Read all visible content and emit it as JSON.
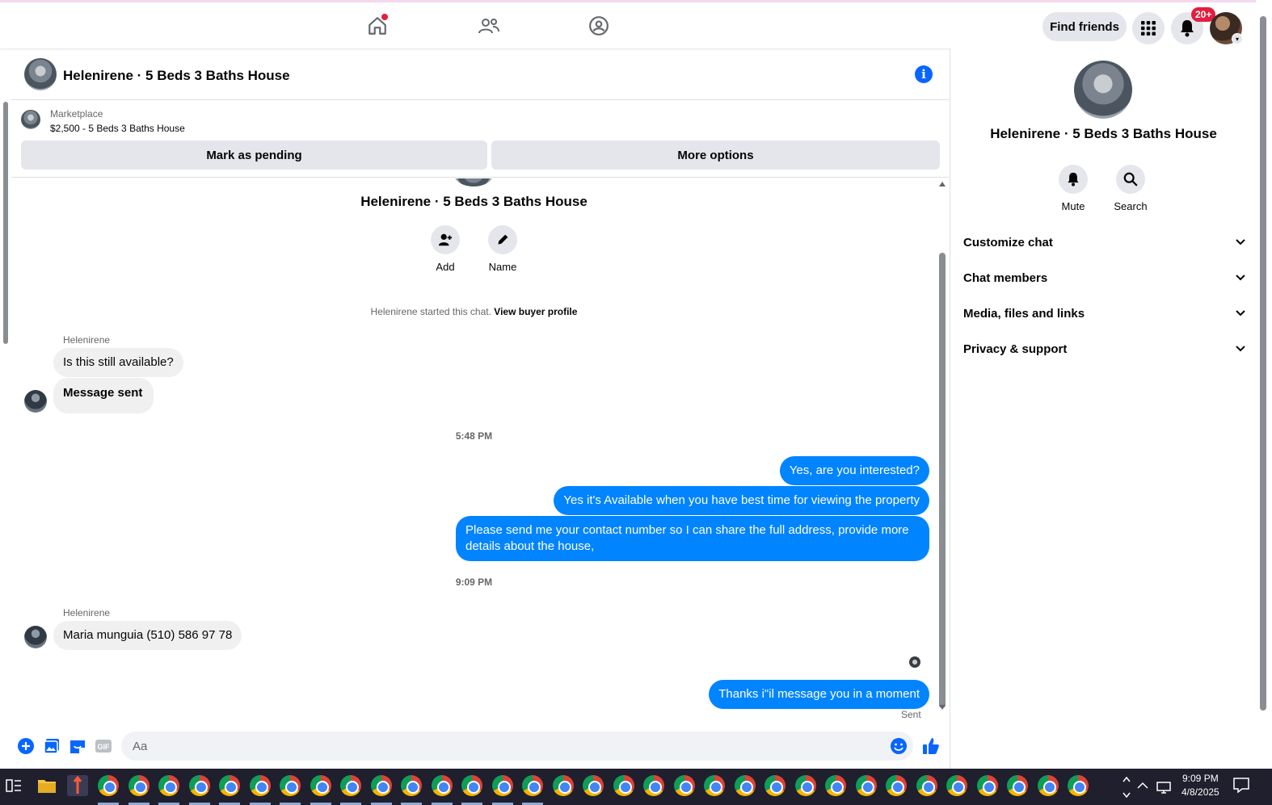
{
  "topbar": {
    "find_friends_label": "Find friends",
    "notif_badge": "20+",
    "icons": [
      "home-icon",
      "friends-icon",
      "groups-icon",
      "apps-grid-icon",
      "bell-icon"
    ]
  },
  "chat": {
    "title": "Helenirene · 5 Beds 3 Baths House",
    "listing": {
      "label": "Marketplace",
      "title": "$2,500 - 5 Beds 3 Baths House",
      "mark_pending_label": "Mark as pending",
      "more_options_label": "More options"
    },
    "intro": {
      "title": "Helenirene · 5 Beds 3 Baths House",
      "add_label": "Add",
      "name_label": "Name",
      "started_text": "Helenirene started this chat.",
      "buyer_profile_link": "View buyer profile"
    },
    "messages": {
      "sender_1": "Helenirene",
      "in_1": "Is this still available?",
      "in_2": "Message sent",
      "time_1": "5:48 PM",
      "out_1": "Yes, are you interested?",
      "out_2": "Yes it's Available when you have best time for viewing the property",
      "out_3": "Please send me your contact number so I can share the full address, provide more details about the house,",
      "time_2": "9:09 PM",
      "sender_2": "Helenirene",
      "in_3": "Maria munguia (510) 586 97 78",
      "out_4": "Thanks i\"il message you in a moment",
      "sent_status": "Sent"
    },
    "composer": {
      "placeholder": "Aa",
      "gif_label": "GIF"
    }
  },
  "right_panel": {
    "title": "Helenirene · 5 Beds 3 Baths House",
    "mute_label": "Mute",
    "search_label": "Search",
    "sections": [
      "Customize chat",
      "Chat members",
      "Media, files and links",
      "Privacy & support"
    ]
  },
  "taskbar": {
    "time": "9:09 PM",
    "date": "4/8/2025"
  },
  "colors": {
    "accent": "#0866ff",
    "outgoing_bubble": "#0084ff",
    "incoming_bubble": "#f0f0f0",
    "badge": "#e41e3f"
  }
}
